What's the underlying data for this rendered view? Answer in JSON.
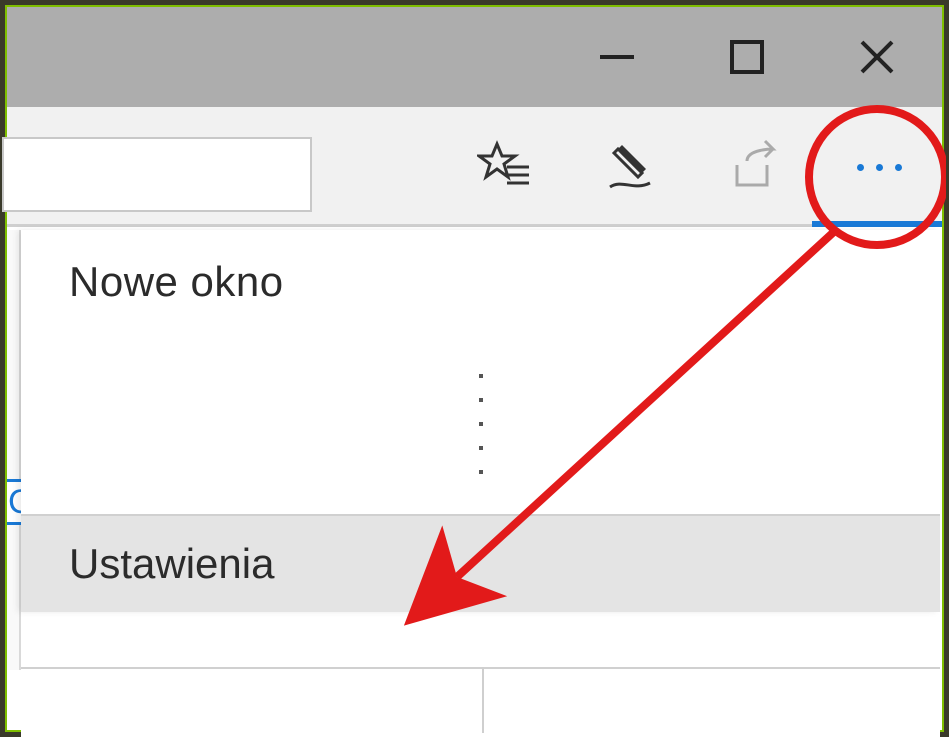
{
  "window": {
    "controls": {
      "minimize": "minimize",
      "maximize": "maximize",
      "close": "close"
    }
  },
  "toolbar": {
    "icons": {
      "favorites": "favorites-star-list-icon",
      "web_note": "pen-icon",
      "share": "share-icon",
      "more": "more-ellipsis-icon"
    }
  },
  "menu": {
    "new_window_label": "Nowe okno",
    "settings_label": "Ustawienia"
  },
  "annotation": {
    "shape": "circle-and-arrow",
    "color": "#e21a1a"
  }
}
